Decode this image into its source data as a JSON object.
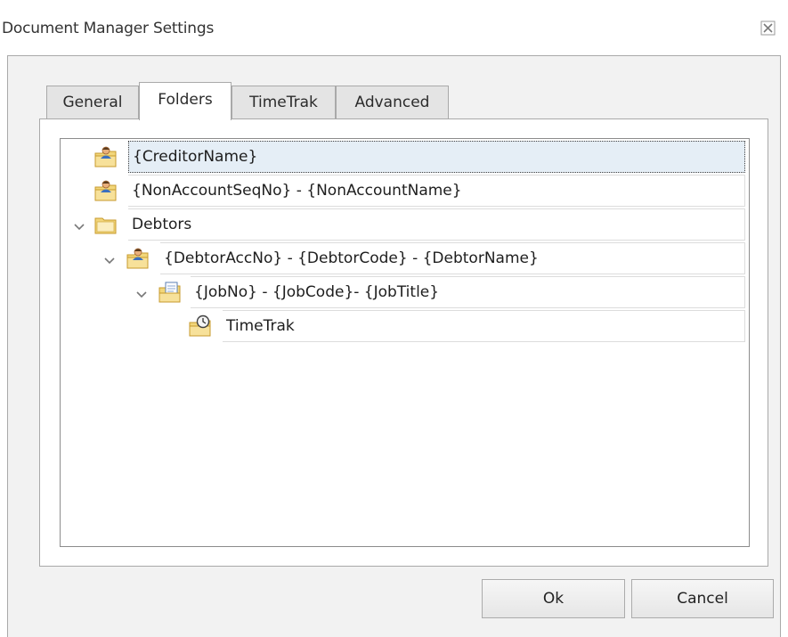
{
  "window": {
    "title": "Document Manager Settings"
  },
  "tabs": [
    {
      "label": "General",
      "active": false
    },
    {
      "label": "Folders",
      "active": true
    },
    {
      "label": "TimeTrak",
      "active": false
    },
    {
      "label": "Advanced",
      "active": false
    }
  ],
  "tree": {
    "nodes": [
      {
        "label": "{CreditorName}",
        "icon": "person-folder-icon",
        "level": 0,
        "expanded": null,
        "selected": true
      },
      {
        "label": "{NonAccountSeqNo} - {NonAccountName}",
        "icon": "person-folder-icon",
        "level": 0,
        "expanded": null,
        "selected": false
      },
      {
        "label": "Debtors",
        "icon": "folder-icon",
        "level": 0,
        "expanded": true,
        "selected": false
      },
      {
        "label": "{DebtorAccNo} - {DebtorCode} - {DebtorName}",
        "icon": "person-folder-icon",
        "level": 1,
        "expanded": true,
        "selected": false
      },
      {
        "label": "{JobNo} -  {JobCode}- {JobTitle}",
        "icon": "document-folder-icon",
        "level": 2,
        "expanded": true,
        "selected": false
      },
      {
        "label": "TimeTrak",
        "icon": "clock-folder-icon",
        "level": 3,
        "expanded": null,
        "selected": false
      }
    ]
  },
  "buttons": {
    "ok_label": "Ok",
    "cancel_label": "Cancel"
  },
  "colors": {
    "selection_fill": "#e5eef6",
    "folder_yellow": "#f2d67a",
    "border": "#a9a9a9"
  }
}
